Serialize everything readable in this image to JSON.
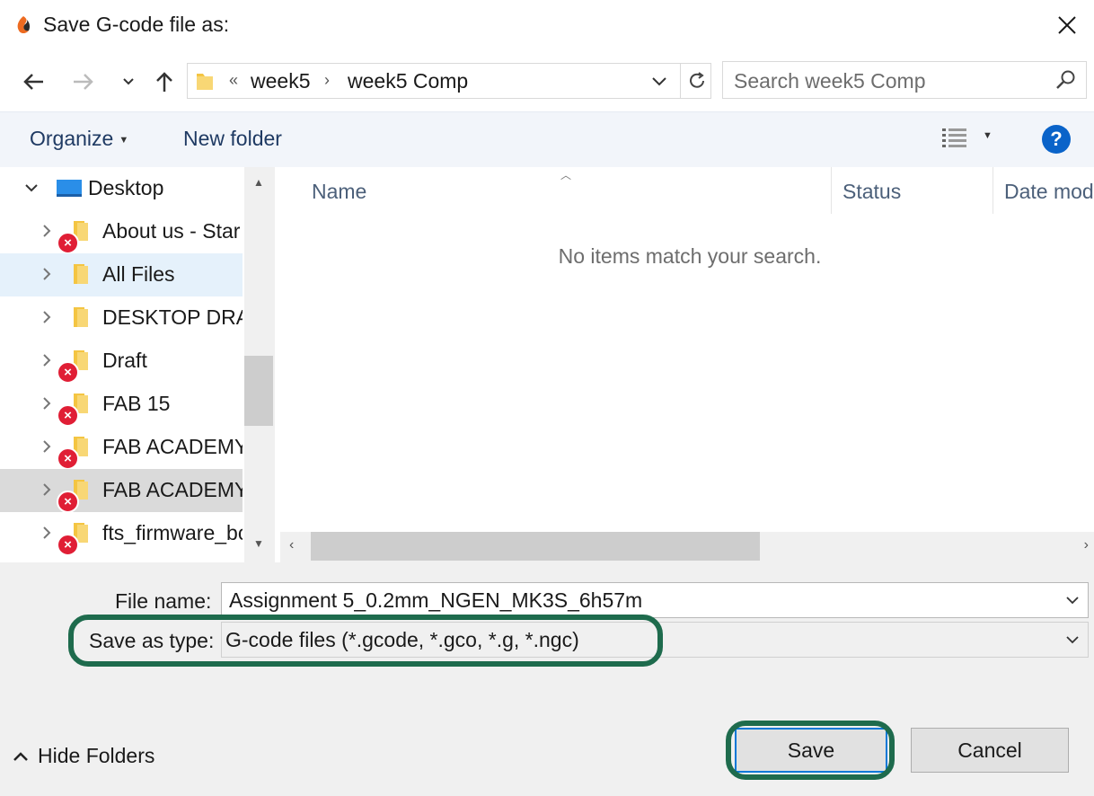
{
  "title": "Save G-code file as:",
  "address": {
    "overflow": "«",
    "crumbs": [
      "week5",
      "week5 Comp"
    ]
  },
  "search": {
    "placeholder": "Search week5 Comp"
  },
  "toolbar": {
    "organize": "Organize",
    "new_folder": "New folder",
    "help": "?"
  },
  "tree": {
    "root": "Desktop",
    "items": [
      {
        "label": "About us - Star",
        "error": true
      },
      {
        "label": "All Files",
        "error": false
      },
      {
        "label": "DESKTOP DRAF",
        "error": false
      },
      {
        "label": "Draft",
        "error": true
      },
      {
        "label": "FAB 15",
        "error": true
      },
      {
        "label": "FAB ACADEMY",
        "error": true
      },
      {
        "label": "FAB ACADEMY",
        "error": true
      },
      {
        "label": "fts_firmware_bc",
        "error": true
      }
    ]
  },
  "columns": {
    "name": "Name",
    "status": "Status",
    "date": "Date mod"
  },
  "empty_message": "No items match your search.",
  "form": {
    "file_name_label": "File name:",
    "file_name_value": "Assignment 5_0.2mm_NGEN_MK3S_6h57m",
    "type_label": "Save as type:",
    "type_value": "G-code files (*.gcode, *.gco, *.g, *.ngc)"
  },
  "footer": {
    "hide_folders": "Hide Folders",
    "save": "Save",
    "cancel": "Cancel"
  },
  "colors": {
    "highlight": "#1e6b4d",
    "accent": "#0078d7",
    "error": "#e01e35",
    "folder": "#f4c542"
  }
}
